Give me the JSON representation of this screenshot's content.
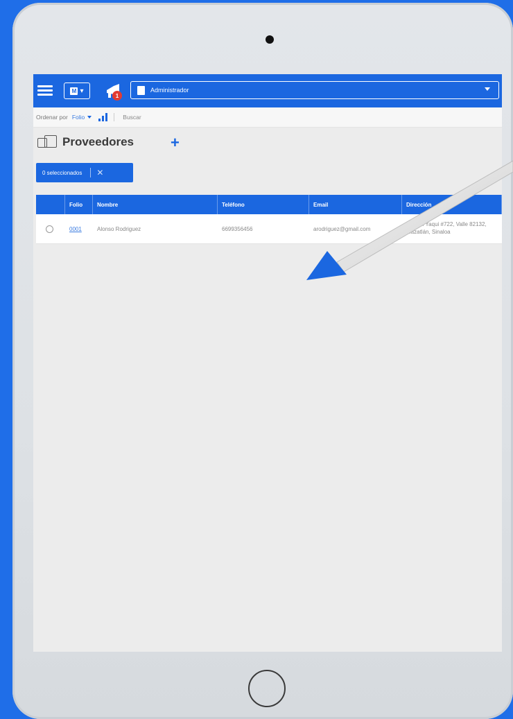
{
  "topbar": {
    "mailbox_letter": "M",
    "notification_count": "1",
    "role_label": "Administrador"
  },
  "sortbar": {
    "order_label": "Ordenar por",
    "order_value": "Folio",
    "search_label": "Buscar"
  },
  "page": {
    "title": "Proveedores",
    "add_label": "+",
    "selected_label": "0 seleccionados",
    "clear_label": "✕"
  },
  "table": {
    "columns": [
      "",
      "Folio",
      "Nombre",
      "Teléfono",
      "Email",
      "Dirección"
    ],
    "rows": [
      {
        "folio": "0001",
        "nombre": "Alonso Rodriguez",
        "telefono": "6699356456",
        "email": "arodriguez@gmail.com",
        "direccion": "Río del Yaqui #722, Valle 82132, Mazatlán, Sinaloa"
      }
    ]
  },
  "colors": {
    "accent": "#1b67e0",
    "background": "#1f6ee8",
    "badge": "#e23b32"
  },
  "icons": {
    "menu": "hamburger-icon",
    "mailbox": "mailbox-icon",
    "notifications": "megaphone-icon",
    "role": "document-icon",
    "providers": "windows-icon",
    "pointer": "arrow-pointer-icon"
  }
}
